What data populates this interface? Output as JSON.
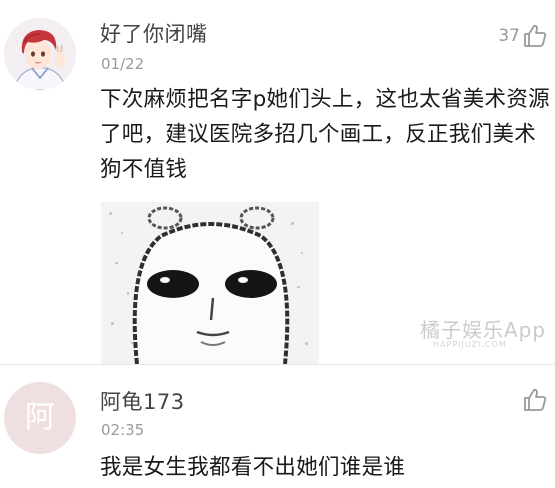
{
  "comments": [
    {
      "username": "好了你闭嘴",
      "timestamp": "01/22",
      "likes": "37",
      "text": "下次麻烦把名字p她们头上，这也太省美术资源了吧，建议医院多招几个画工，反正我们美术狗不值钱",
      "avatar_icon": "anime-boy-avatar",
      "attachment_icon": "meme-face-sticker"
    },
    {
      "username": "阿龟173",
      "timestamp": "02:35",
      "avatar_letter": "阿",
      "text": "我是女生我都看不出她们谁是谁",
      "avatar_color": "#f0dfe0"
    }
  ],
  "watermark": {
    "text": "橘子娱乐App",
    "sub": "HAPPIJUZI.COM"
  },
  "like_icon": "thumbs-up-icon"
}
